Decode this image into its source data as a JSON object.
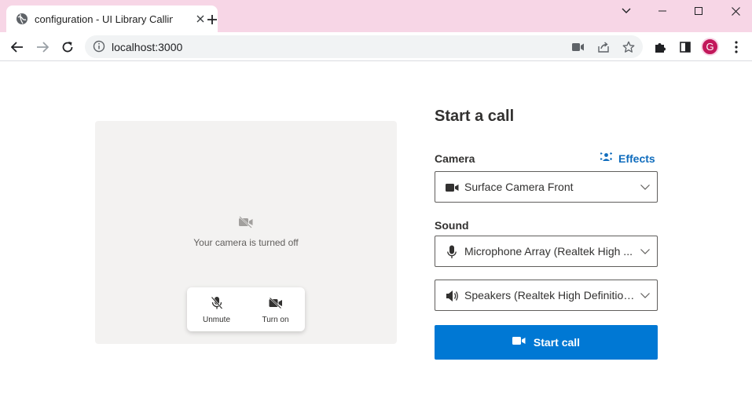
{
  "browser": {
    "tab_title": "configuration - UI Library Calling",
    "url": "localhost:3000",
    "avatar_initial": "G"
  },
  "preview": {
    "camera_off_text": "Your camera is turned off",
    "unmute_label": "Unmute",
    "turn_on_label": "Turn on"
  },
  "config": {
    "heading": "Start a call",
    "camera_label": "Camera",
    "effects_label": "Effects",
    "camera_value": "Surface Camera Front",
    "sound_label": "Sound",
    "microphone_value": "Microphone Array (Realtek High ...",
    "speaker_value": "Speakers (Realtek High Definition...",
    "start_call_label": "Start call"
  },
  "colors": {
    "accent": "#0078d4",
    "link": "#0f6cbd",
    "titlebar": "#f7d6e6",
    "preview_bg": "#f3f2f1",
    "avatar": "#c2185b"
  }
}
